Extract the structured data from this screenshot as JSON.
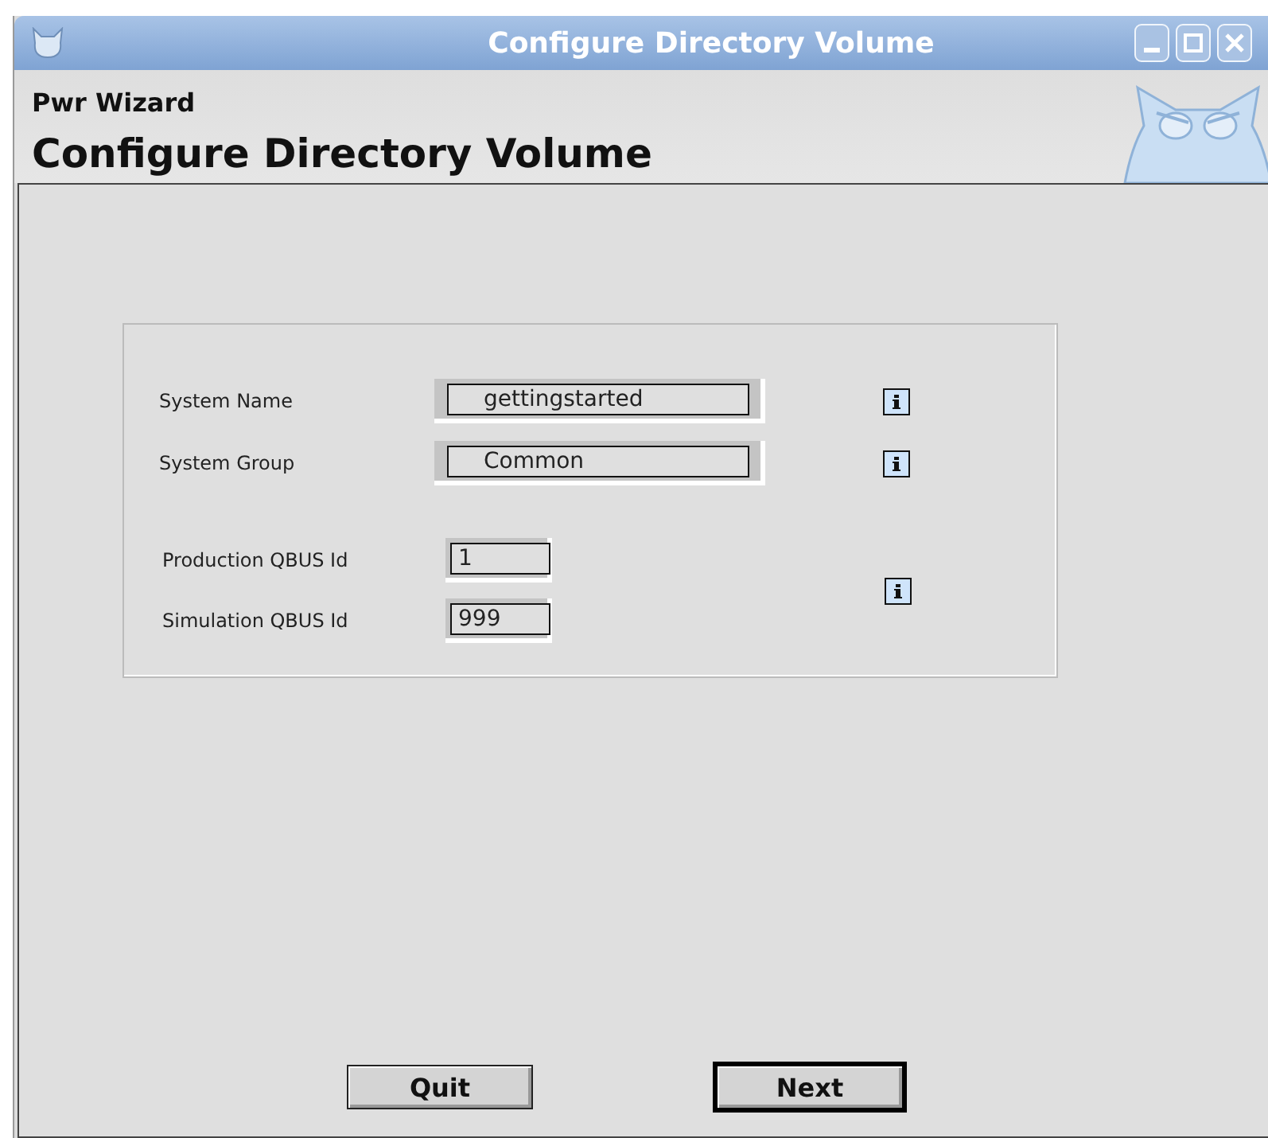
{
  "window": {
    "title": "Configure Directory Volume"
  },
  "header": {
    "app_name": "Pwr Wizard",
    "page_title": "Configure Directory Volume"
  },
  "sections": [
    {
      "kind": "per_field",
      "fields": [
        {
          "label": "System Name",
          "value": "gettingstarted",
          "kind": "wide"
        },
        {
          "label": "System Group",
          "value": "Common",
          "kind": "wide"
        }
      ]
    },
    {
      "kind": "shared",
      "fields": [
        {
          "label": "Production QBUS Id",
          "value": "1",
          "kind": "narrow"
        },
        {
          "label": "Simulation QBUS Id",
          "value": "999",
          "kind": "narrow"
        }
      ]
    }
  ],
  "buttons": [
    {
      "label": "Quit",
      "default": false
    },
    {
      "label": "Next",
      "default": true
    }
  ]
}
